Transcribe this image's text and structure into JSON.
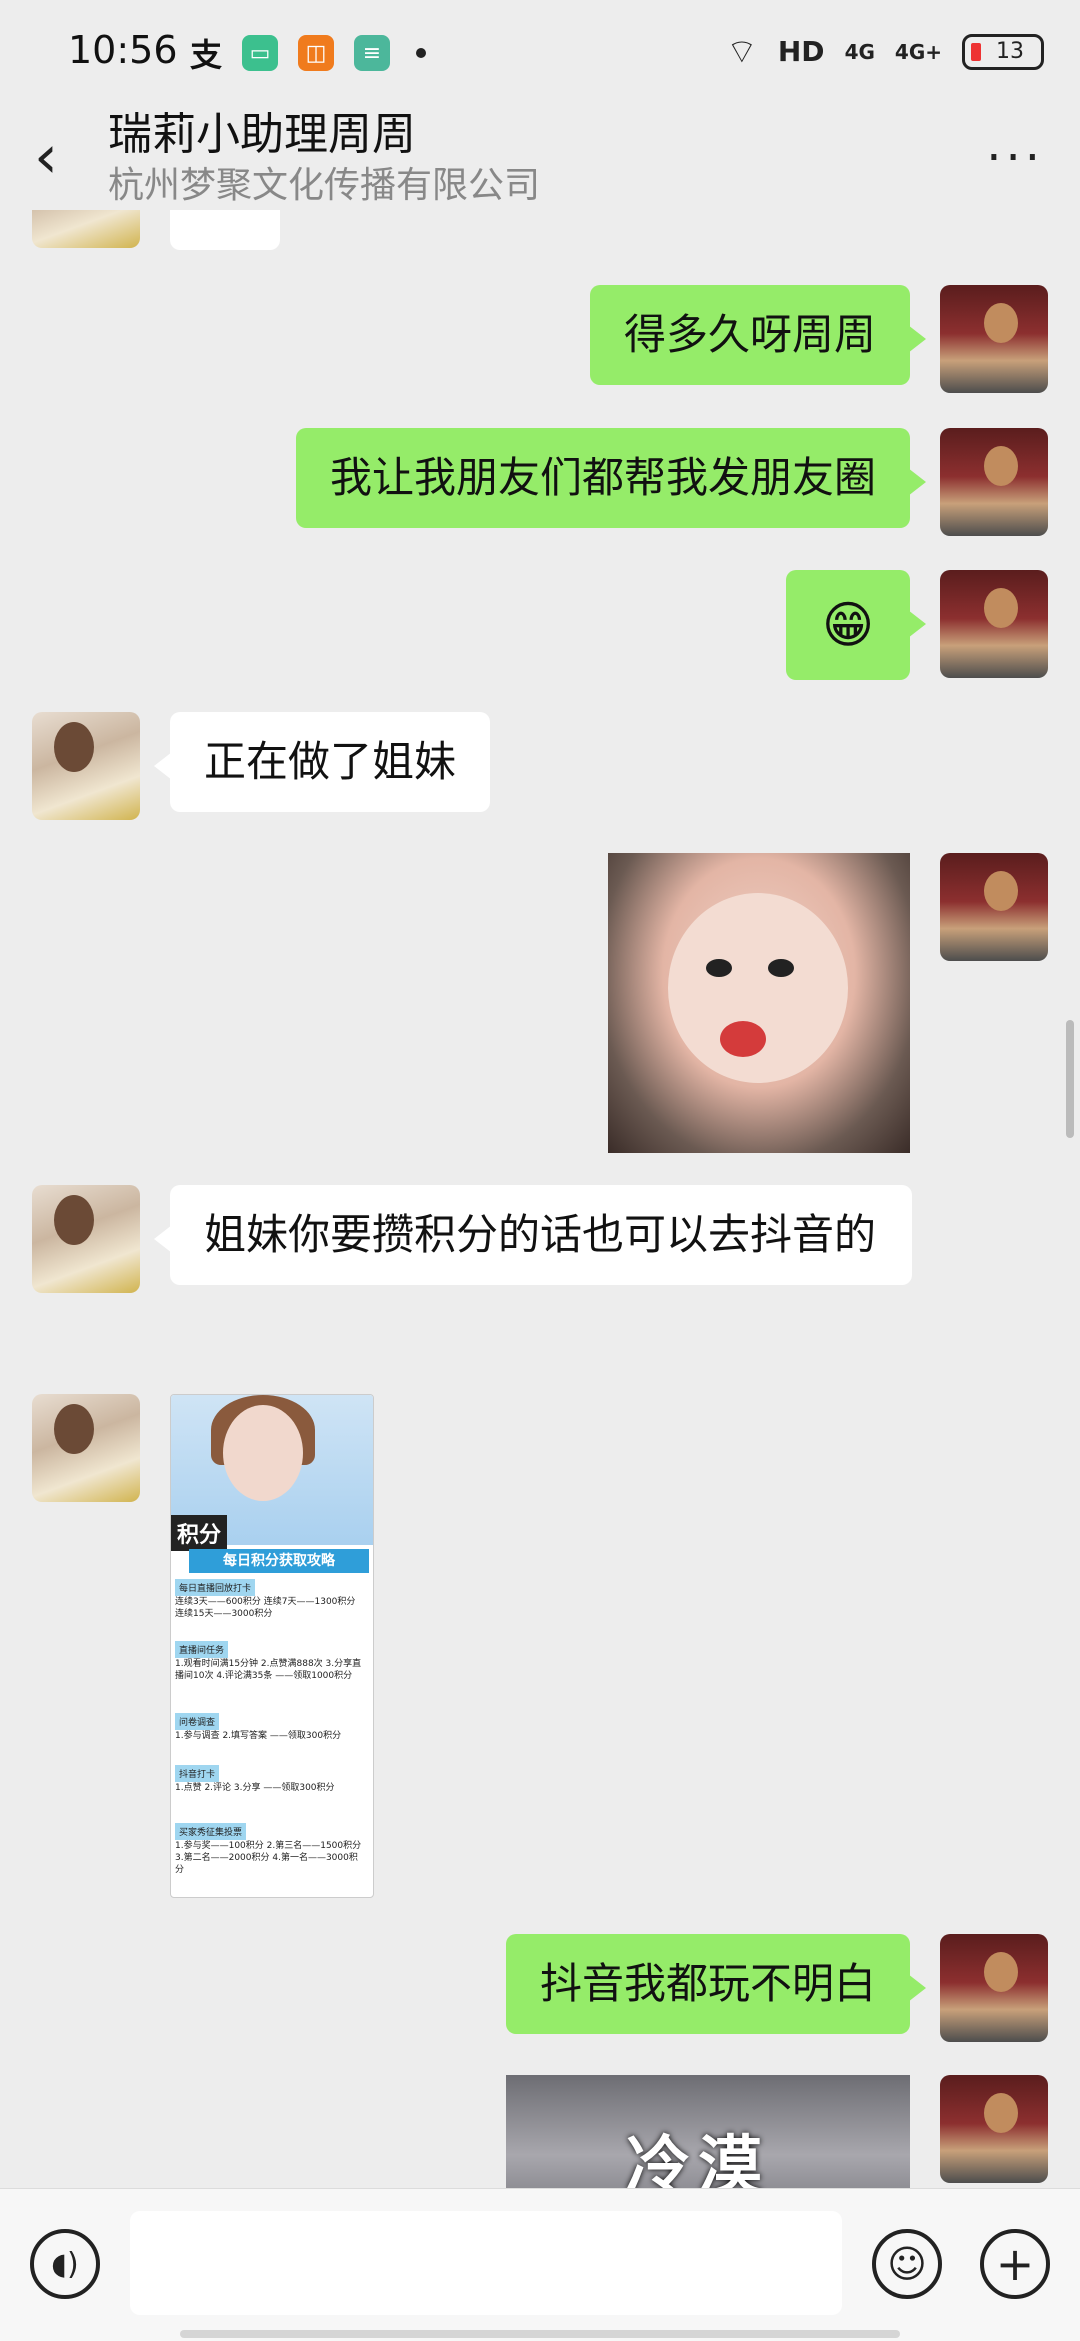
{
  "status_bar": {
    "time": "10:56",
    "network_label": "HD",
    "signal_1": "4G",
    "signal_2": "4G+",
    "battery": "13"
  },
  "header": {
    "title": "瑞莉小助理周周",
    "subtitle": "杭州梦聚文化传播有限公司"
  },
  "messages": [
    {
      "sender": "me",
      "text": "得多久呀周周"
    },
    {
      "sender": "me",
      "text": "我让我朋友们都帮我发朋友圈"
    },
    {
      "sender": "me",
      "emoji": "😁"
    },
    {
      "sender": "them",
      "text": "正在做了姐妹"
    },
    {
      "sender": "me",
      "image": "baby-photo"
    },
    {
      "sender": "them",
      "text": "姐妹你要攒积分的话也可以去抖音的"
    },
    {
      "sender": "them",
      "image": "points-poster"
    },
    {
      "sender": "me",
      "text": "抖音我都玩不明白"
    },
    {
      "sender": "me",
      "image": "meme-photo"
    }
  ],
  "poster": {
    "badge": "积分",
    "heading": "每日积分获取攻略",
    "rows": [
      {
        "tag": "每日直播回放打卡",
        "lines": "连续3天——600积分 连续7天——1300积分 连续15天——3000积分"
      },
      {
        "tag": "直播间任务",
        "lines": "1.观看时间满15分钟 2.点赞满888次 3.分享直播间10次 4.评论满35条 ——领取1000积分"
      },
      {
        "tag": "问卷调查",
        "lines": "1.参与调查 2.填写答案 ——领取300积分"
      },
      {
        "tag": "抖音打卡",
        "lines": "1.点赞 2.评论 3.分享 ——领取300积分"
      },
      {
        "tag": "买家秀征集投票",
        "lines": "1.参与奖——100积分 2.第三名——1500积分 3.第二名——2000积分 4.第一名——3000积分"
      }
    ]
  },
  "meme_text": "冷漠",
  "input": {
    "placeholder": "",
    "value": ""
  },
  "icons": [
    "voice-icon",
    "emoji-icon",
    "plus-icon",
    "back-icon",
    "more-icon"
  ]
}
